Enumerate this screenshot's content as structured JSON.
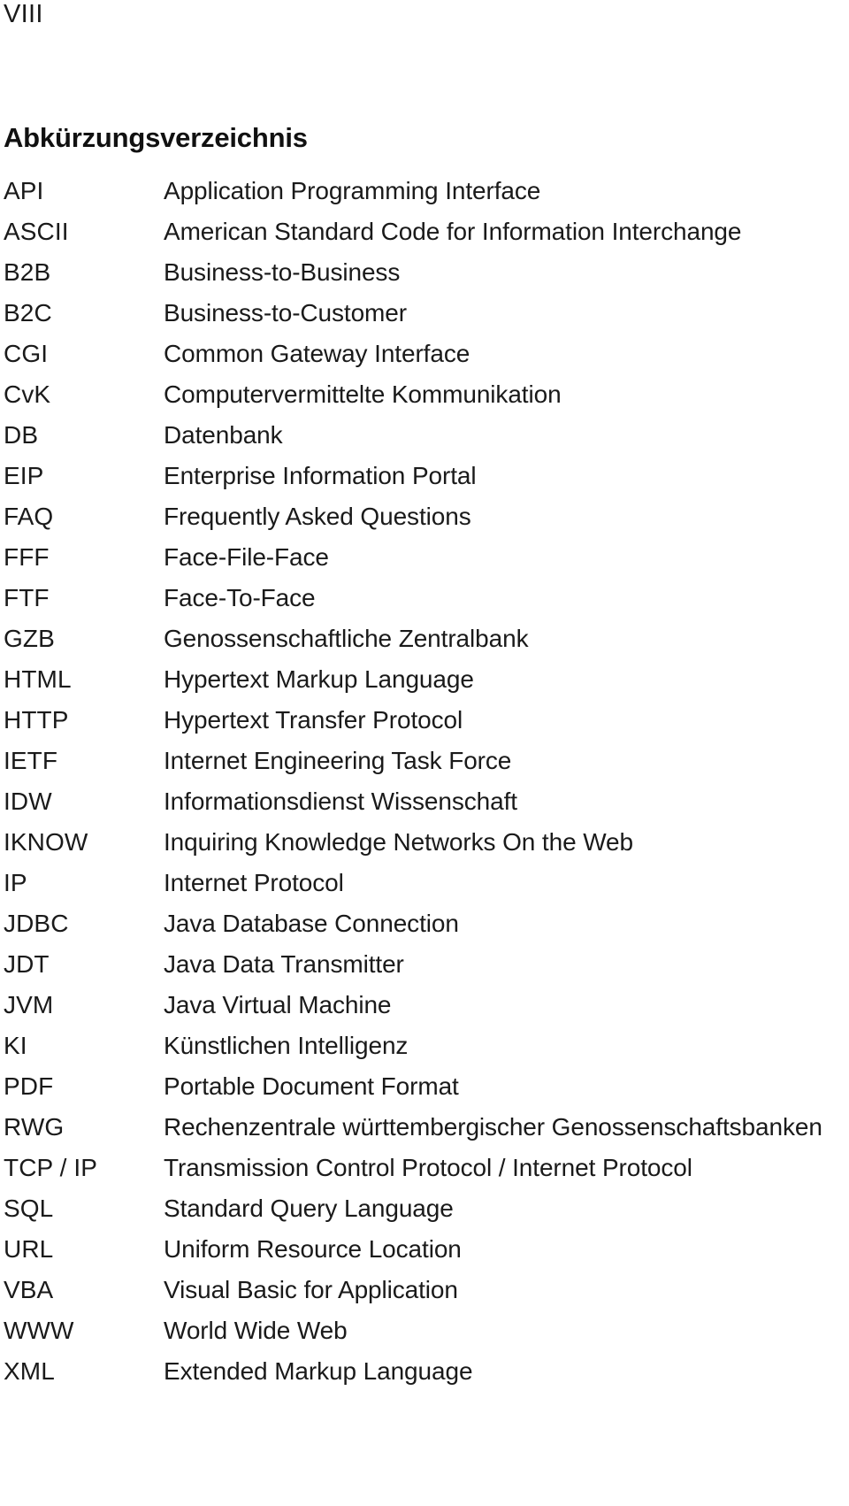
{
  "page": {
    "page_number": "VIII",
    "section_title": "Abkürzungsverzeichnis"
  },
  "abbreviations": [
    {
      "term": "API",
      "definition": "Application Programming Interface"
    },
    {
      "term": "ASCII",
      "definition": "American Standard Code for Information Interchange"
    },
    {
      "term": "B2B",
      "definition": "Business-to-Business"
    },
    {
      "term": "B2C",
      "definition": "Business-to-Customer"
    },
    {
      "term": "CGI",
      "definition": "Common Gateway Interface"
    },
    {
      "term": "CvK",
      "definition": "Computervermittelte Kommunikation"
    },
    {
      "term": "DB",
      "definition": "Datenbank"
    },
    {
      "term": "EIP",
      "definition": "Enterprise Information Portal"
    },
    {
      "term": "FAQ",
      "definition": "Frequently Asked Questions"
    },
    {
      "term": "FFF",
      "definition": "Face-File-Face"
    },
    {
      "term": "FTF",
      "definition": "Face-To-Face"
    },
    {
      "term": "GZB",
      "definition": "Genossenschaftliche Zentralbank"
    },
    {
      "term": "HTML",
      "definition": "Hypertext Markup Language"
    },
    {
      "term": "HTTP",
      "definition": "Hypertext Transfer Protocol"
    },
    {
      "term": "IETF",
      "definition": "Internet Engineering Task Force"
    },
    {
      "term": "IDW",
      "definition": "Informationsdienst Wissenschaft"
    },
    {
      "term": "IKNOW",
      "definition": "Inquiring Knowledge Networks On the Web"
    },
    {
      "term": "IP",
      "definition": "Internet Protocol"
    },
    {
      "term": "JDBC",
      "definition": "Java Database Connection"
    },
    {
      "term": "JDT",
      "definition": "Java Data Transmitter"
    },
    {
      "term": "JVM",
      "definition": "Java Virtual Machine"
    },
    {
      "term": "KI",
      "definition": "Künstlichen Intelligenz"
    },
    {
      "term": "PDF",
      "definition": "Portable Document Format"
    },
    {
      "term": "RWG",
      "definition": "Rechenzentrale württembergischer Genossenschaftsbanken"
    },
    {
      "term": "TCP / IP",
      "definition": "Transmission Control Protocol / Internet Protocol"
    },
    {
      "term": "SQL",
      "definition": "Standard Query Language"
    },
    {
      "term": "URL",
      "definition": "Uniform Resource Location"
    },
    {
      "term": "VBA",
      "definition": "Visual Basic for Application"
    },
    {
      "term": "WWW",
      "definition": "World Wide Web"
    },
    {
      "term": "XML",
      "definition": "Extended Markup Language"
    }
  ]
}
